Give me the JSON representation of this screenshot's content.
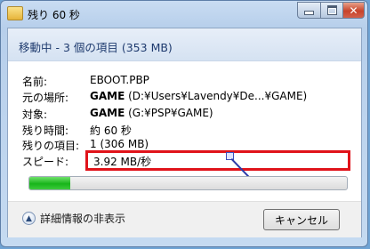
{
  "window": {
    "title": "残り 60 秒"
  },
  "header": {
    "text": "移動中 - 3 個の項目 (353 MB)"
  },
  "info": {
    "name_label": "名前:",
    "name_value": "EBOOT.PBP",
    "from_label": "元の場所:",
    "from_bold": "GAME",
    "from_path": " (D:¥Users¥Lavendy¥De...¥GAME)",
    "to_label": "対象:",
    "to_bold": "GAME",
    "to_path": " (G:¥PSP¥GAME)",
    "time_label": "残り時間:",
    "time_value": "約 60 秒",
    "items_label": "残りの項目:",
    "items_value": "1 (306 MB)",
    "speed_label": "スピード:",
    "speed_value": "3.92 MB/秒"
  },
  "progress": {
    "fraction": 0.13,
    "color": "#17b51a"
  },
  "footer": {
    "details_label": "詳細情報の非表示",
    "cancel_label": "キャンセル"
  },
  "icons": {
    "app": "folder-move-icon",
    "toggle": "chevron-up-icon"
  },
  "colors": {
    "highlight": "#e0131a"
  }
}
